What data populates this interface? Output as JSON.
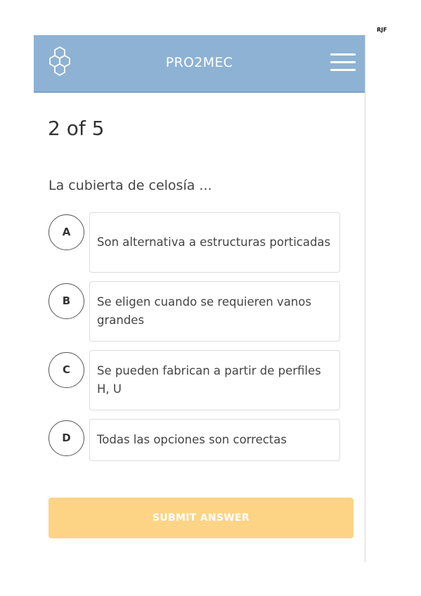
{
  "corner_mark": "RJF",
  "header": {
    "title": "PRO2MEC",
    "logo_icon": "hexagon-cluster-icon",
    "menu_icon": "hamburger-menu-icon",
    "background_color": "#8db2d4"
  },
  "quiz": {
    "progress": "2 of 5",
    "question": "La cubierta de celosía ...",
    "options": [
      {
        "letter": "A",
        "text": "Son alternativa a estructuras porticadas"
      },
      {
        "letter": "B",
        "text": "Se eligen cuando se requieren vanos grandes"
      },
      {
        "letter": "C",
        "text": "Se pueden fabrican a partir de perfiles H, U"
      },
      {
        "letter": "D",
        "text": "Todas las opciones son correctas"
      }
    ],
    "submit_label": "SUBMIT ANSWER",
    "submit_color": "#fdd486"
  }
}
